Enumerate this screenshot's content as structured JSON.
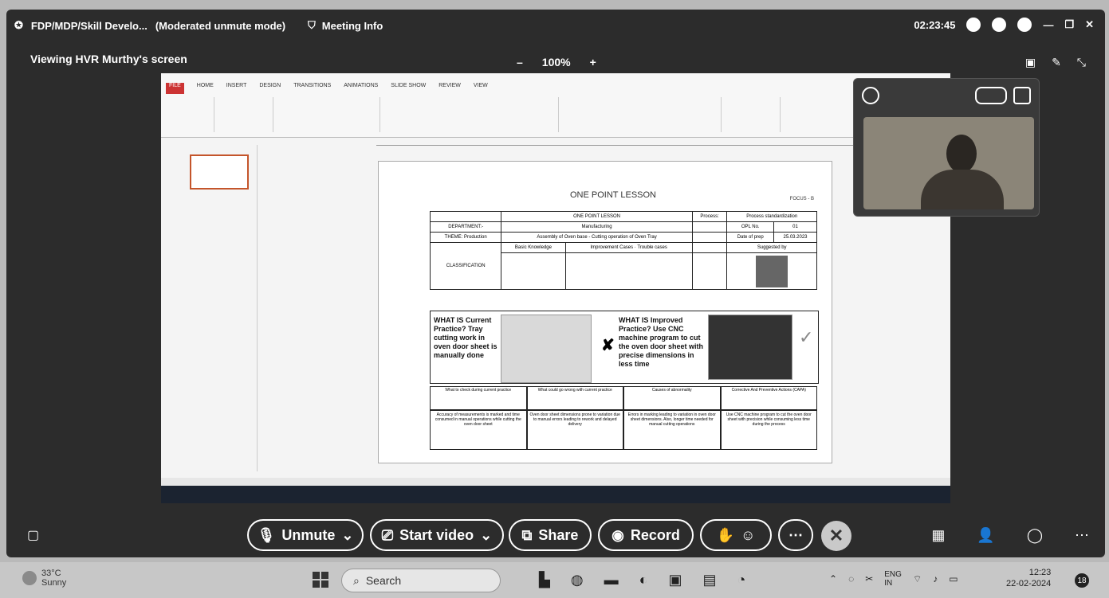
{
  "titlebar": {
    "app_title": "FDP/MDP/Skill Develo...",
    "mode": "(Moderated unmute mode)",
    "meeting_info": "Meeting Info",
    "timer": "02:23:45"
  },
  "viewing_label": "Viewing HVR Murthy's screen",
  "zoom": {
    "minus": "–",
    "value": "100%",
    "plus": "+"
  },
  "slide": {
    "title": "ONE POINT LESSON",
    "logo_text": "FOCUS - B",
    "table": {
      "header": "ONE POINT LESSON",
      "process_label": "Process:",
      "process_value": "Process standardization",
      "dept_label": "DEPARTMENT:-",
      "dept_value": "Manufacturing",
      "opl_label": "OPL No.",
      "opl_value": "01",
      "product_label": "THEME: Production",
      "product_value": "Assembly of Oven base - Cutting operation of Oven Tray",
      "date_label": "Date of prep",
      "date_value": "25.03.2023",
      "classification": "CLASSIFICATION",
      "basic": "Basic Knowledge",
      "improvement": "Improvement Cases",
      "trouble": "Trouble cases",
      "suggested": "Suggested by"
    },
    "current_text": "WHAT IS Current Practice? Tray cutting work in oven door sheet is manually done",
    "improved_text": "WHAT IS Improved Practice? Use CNC machine program to cut the oven door sheet with precise dimensions in less time",
    "steps": [
      "What to check during current practice",
      "What could go wrong with current practice",
      "Causes of abnormality",
      "Corrective And Preventive Actions (CAPA)"
    ],
    "steps_body": [
      "Accuracy of measurements is marked and time consumed in manual operations while cutting the oven door sheet",
      "Oven door sheet dimensions prone to variation due to manual errors leading to rework and delayed delivery",
      "Errors in marking leading to variation in oven door sheet dimensions. Also, longer time needed for manual cutting operations",
      "Use CNC machine program to cut the oven door sheet with precision while consuming less time during the process"
    ]
  },
  "ribbon_tabs": [
    "FILE",
    "HOME",
    "INSERT",
    "DESIGN",
    "TRANSITIONS",
    "ANIMATIONS",
    "SLIDE SHOW",
    "REVIEW",
    "VIEW"
  ],
  "controls": {
    "unmute": "Unmute",
    "start_video": "Start video",
    "share": "Share",
    "record": "Record"
  },
  "os_taskbar": {
    "temperature": "33°C",
    "weather": "Sunny",
    "search": "Search",
    "lang1": "ENG",
    "lang2": "IN",
    "time": "12:23",
    "date": "22-02-2024",
    "badge": "18"
  }
}
